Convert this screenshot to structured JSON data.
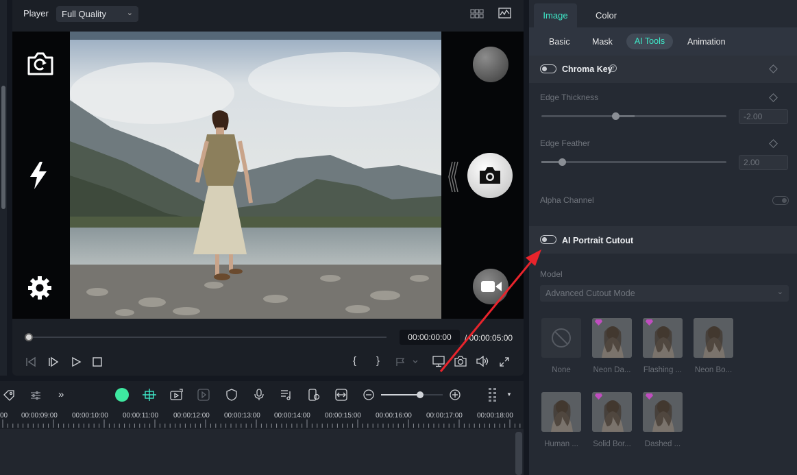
{
  "player": {
    "label": "Player",
    "quality": "Full Quality",
    "timecode": "00:00:00:00",
    "duration": "/ 00:00:05:00"
  },
  "panel": {
    "tabs": [
      "Image",
      "Color"
    ],
    "subtabs": [
      "Basic",
      "Mask",
      "AI Tools",
      "Animation"
    ],
    "chroma_key": {
      "label": "Chroma Key",
      "help_icon": "?",
      "edge_thickness_label": "Edge Thickness",
      "edge_thickness_value": "-2.00",
      "edge_feather_label": "Edge Feather",
      "edge_feather_value": "2.00",
      "alpha_channel_label": "Alpha Channel"
    },
    "portrait": {
      "label": "AI Portrait Cutout",
      "model_label": "Model",
      "model_value": "Advanced Cutout Mode",
      "presets": [
        "None",
        "Neon Da...",
        "Flashing ...",
        "Neon Bo...",
        "Human ...",
        "Solid Bor...",
        "Dashed ..."
      ]
    }
  },
  "timeline": {
    "ticks": [
      "00",
      "00:00:09:00",
      "00:00:10:00",
      "00:00:11:00",
      "00:00:12:00",
      "00:00:13:00",
      "00:00:14:00",
      "00:00:15:00",
      "00:00:16:00",
      "00:00:17:00",
      "00:00:18:00"
    ]
  },
  "colors": {
    "accent": "#3ee8c8",
    "annotation_arrow": "#e8242c"
  }
}
